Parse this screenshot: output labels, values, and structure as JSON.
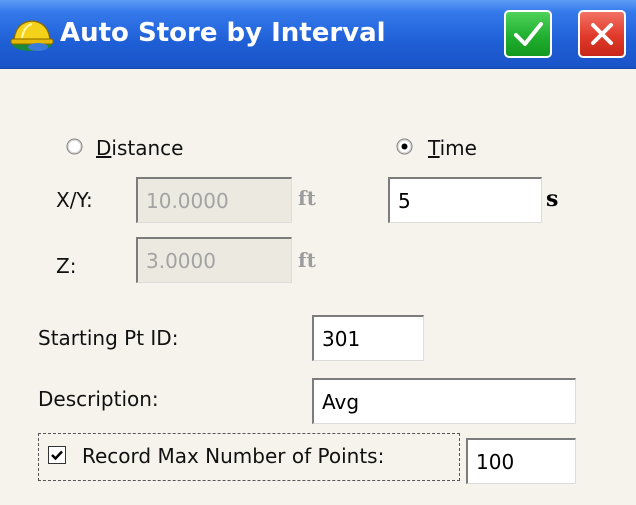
{
  "window": {
    "title": "Auto Store by Interval",
    "ok_icon": "checkmark-icon",
    "close_icon": "close-icon",
    "accent": "#1f5fd6",
    "ok_color": "#21b030",
    "close_color": "#e0392a"
  },
  "mode": {
    "distance_label": "Distance",
    "distance_access_key": "D",
    "time_label": "Time",
    "time_access_key": "T",
    "selected": "Time"
  },
  "distance": {
    "xy_label": "X/Y:",
    "xy_value": "10.0000",
    "xy_unit": "ft",
    "z_label": "Z:",
    "z_value": "3.0000",
    "z_unit": "ft"
  },
  "time": {
    "value": "5",
    "unit": "s"
  },
  "starting_pt": {
    "label": "Starting Pt ID:",
    "value": "301"
  },
  "description": {
    "label": "Description:",
    "value": "Avg"
  },
  "max_points": {
    "label": "Record Max Number of Points:",
    "checked": true,
    "value": "100"
  }
}
